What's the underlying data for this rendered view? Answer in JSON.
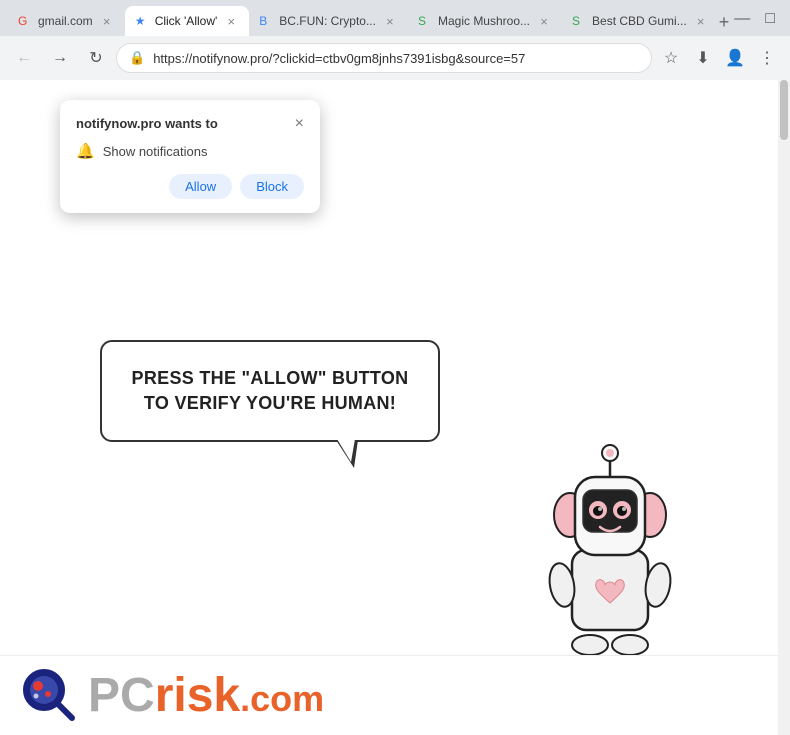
{
  "browser": {
    "tabs": [
      {
        "id": "tab1",
        "label": "gmail.com",
        "favicon": "G",
        "active": false
      },
      {
        "id": "tab2",
        "label": "Click 'Allow'",
        "favicon": "★",
        "active": true
      },
      {
        "id": "tab3",
        "label": "BC.FUN: Crypto...",
        "favicon": "B",
        "active": false
      },
      {
        "id": "tab4",
        "label": "Magic Mushroo...",
        "favicon": "S",
        "active": false
      },
      {
        "id": "tab5",
        "label": "Best CBD Gumi...",
        "favicon": "S",
        "active": false
      }
    ],
    "address": "https://notifynow.pro/?clickid=ctbv0gm8jnhs7391isbg&source=57"
  },
  "notification_popup": {
    "title_normal": "",
    "title_bold": "notifynow.pro",
    "title_suffix": " wants to",
    "show_notifications_label": "Show notifications",
    "allow_label": "Allow",
    "block_label": "Block"
  },
  "page": {
    "message": "PRESS THE \"ALLOW\" BUTTON TO VERIFY YOU'RE HUMAN!"
  },
  "pcrisk": {
    "pc_text": "PC",
    "risk_text": "risk",
    "dot_com": ".com"
  },
  "icons": {
    "back": "←",
    "forward": "→",
    "reload": "↻",
    "lock": "🔒",
    "star": "☆",
    "download": "⬇",
    "profile": "👤",
    "menu": "⋮",
    "close": "×",
    "bell": "🔔",
    "minimize": "—",
    "maximize": "□"
  }
}
